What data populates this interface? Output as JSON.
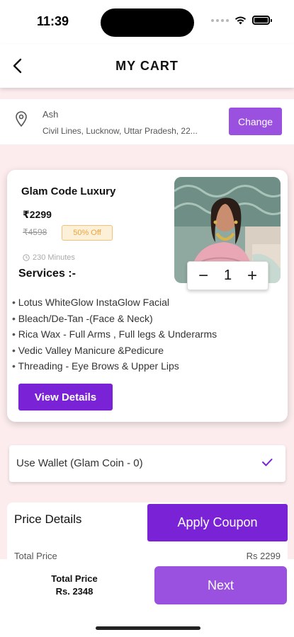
{
  "status_bar": {
    "time": "11:39"
  },
  "header": {
    "title": "MY CART"
  },
  "address": {
    "name": "Ash",
    "line": "Civil Lines, Lucknow, Uttar Pradesh, 22...",
    "change_label": "Change"
  },
  "product": {
    "name": "Glam Code Luxury",
    "price": "₹2299",
    "original_price": "₹4598",
    "discount": "50% Off",
    "duration": "230 Minutes",
    "services_heading": "Services :-",
    "services": [
      "Lotus WhiteGlow InstaGlow Facial",
      "Bleach/De-Tan -(Face & Neck)",
      "Rica Wax - Full Arms , Full legs & Underarms",
      "Vedic Valley Manicure &Pedicure",
      "Threading - Eye Brows & Upper Lips"
    ],
    "view_details_label": "View Details",
    "quantity": "1",
    "minus": "−",
    "plus": "+"
  },
  "wallet": {
    "label": "Use Wallet (Glam Coin - 0)"
  },
  "price_details": {
    "heading": "Price Details",
    "apply_coupon_label": "Apply Coupon",
    "total_price_label": "Total Price",
    "total_price_value": "Rs 2299"
  },
  "footer": {
    "total_label": "Total Price",
    "total_value": "Rs. 2348",
    "next_label": "Next"
  },
  "colors": {
    "primary_purple": "#7a22d6",
    "light_purple": "#9b51e0",
    "page_background": "#fcecee",
    "discount_orange": "#f0a33a"
  }
}
